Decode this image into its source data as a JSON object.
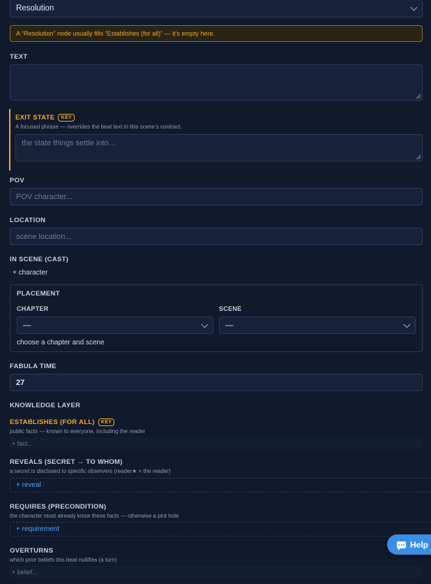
{
  "node_type": {
    "value": "Resolution"
  },
  "warning": {
    "text": "A “Resolution” node usually fills “Establishes (for all)” — it’s empty here."
  },
  "text_section": {
    "label": "TEXT",
    "value": ""
  },
  "exit_state": {
    "label": "EXIT STATE",
    "badge": "KEY",
    "hint": "A focused phrase — overrides the beat text in this scene’s contract.",
    "placeholder": "the state things settle into…"
  },
  "pov": {
    "label": "POV",
    "placeholder": "POV character..."
  },
  "location": {
    "label": "LOCATION",
    "placeholder": "scene location..."
  },
  "cast": {
    "label": "IN SCENE (CAST)",
    "add_label": "+ character"
  },
  "placement": {
    "title": "PLACEMENT",
    "chapter_label": "CHAPTER",
    "chapter_value": "—",
    "scene_label": "SCENE",
    "scene_value": "—",
    "note": "choose a chapter and scene"
  },
  "fabula_time": {
    "label": "FABULA TIME",
    "value": "27"
  },
  "knowledge_layer": {
    "label": "KNOWLEDGE LAYER"
  },
  "establishes": {
    "label": "ESTABLISHES (FOR ALL)",
    "badge": "KEY",
    "hint": "public facts — known to everyone, including the reader",
    "add_label": "+ fact..."
  },
  "reveals": {
    "label": "REVEALS (SECRET → TO WHOM)",
    "hint": "a secret is disclosed to specific observers (reader★ = the reader)",
    "add_label": "+ reveal"
  },
  "requires": {
    "label": "REQUIRES (PRECONDITION)",
    "hint": "the character must already know these facts — otherwise a plot hole",
    "add_label": "+ requirement"
  },
  "overturns": {
    "label": "OVERTURNS",
    "hint": "which prior beliefs this beat nullifies (a turn)",
    "add_label": "+ belief..."
  },
  "help_button": {
    "label": "Help",
    "icon": "chat-bubble-icon"
  },
  "colors": {
    "accent": "#f5a623",
    "link": "#4da3ff",
    "background": "#111a2c",
    "help": "#3a8ee6"
  }
}
